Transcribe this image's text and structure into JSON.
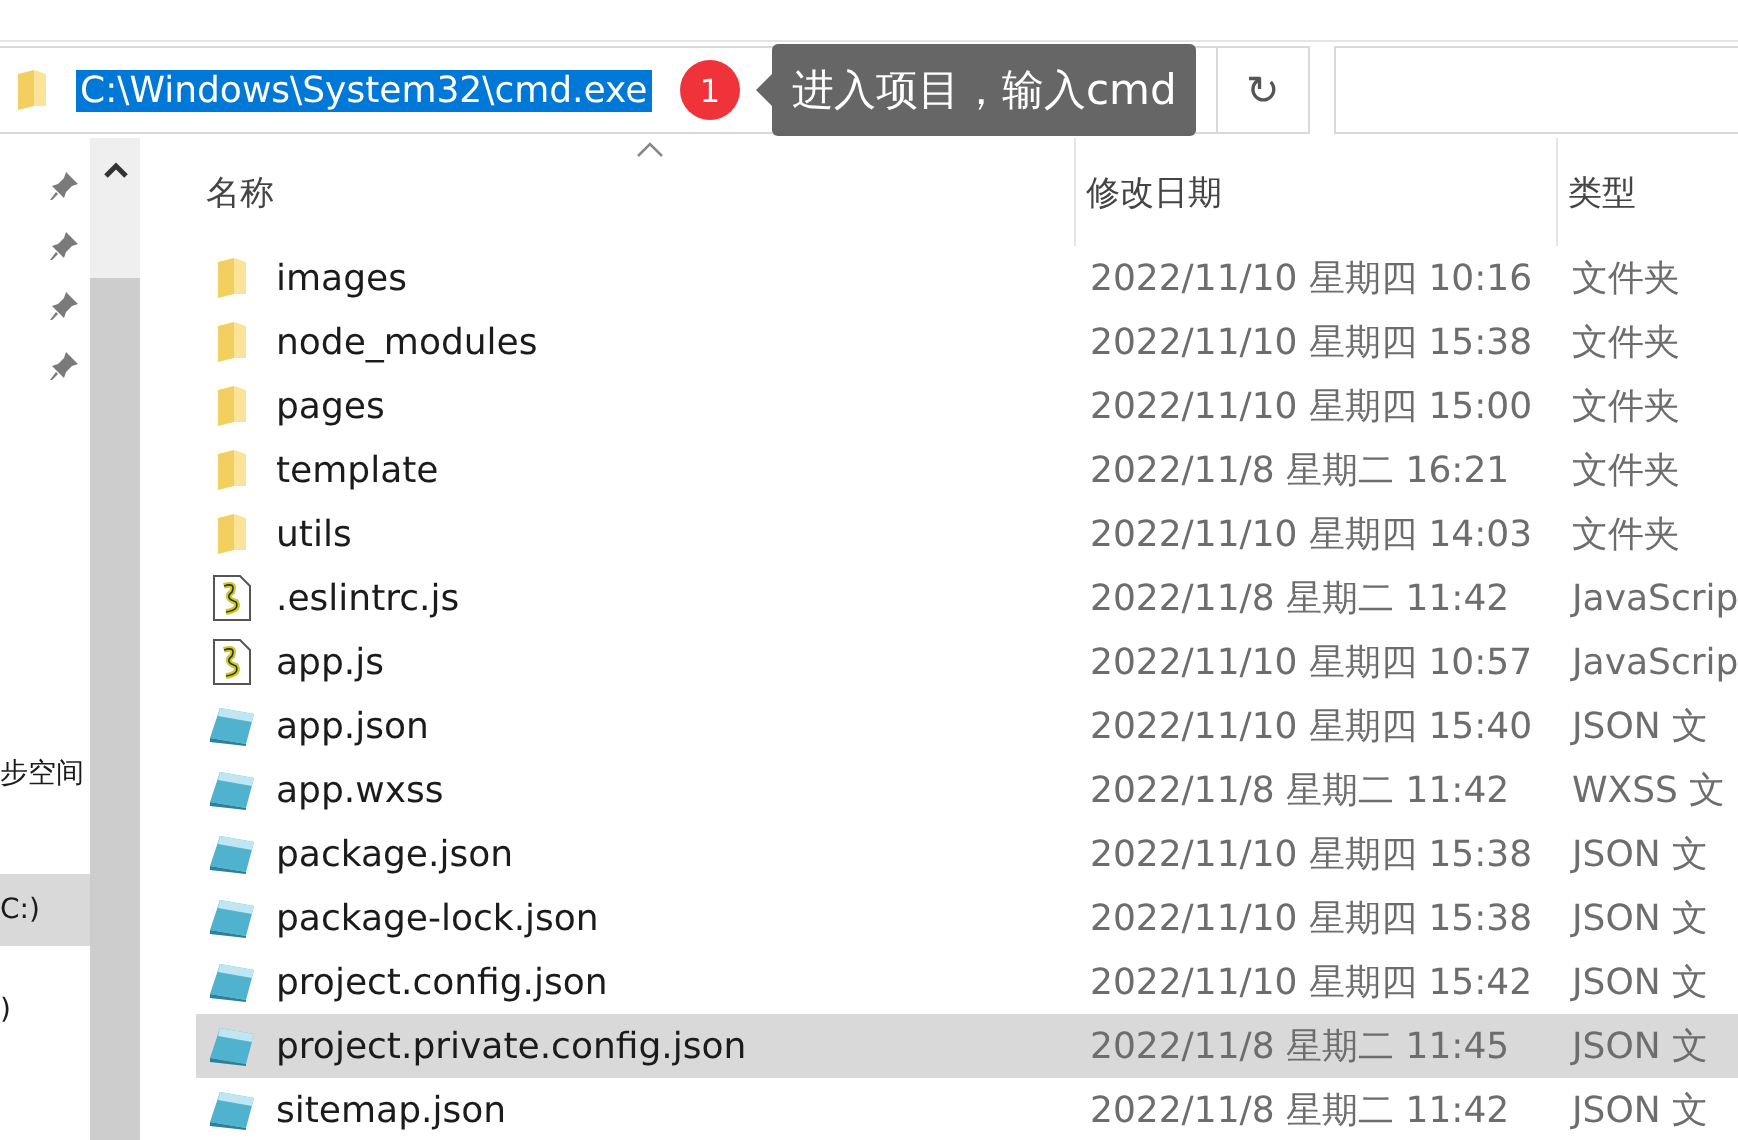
{
  "address_bar": {
    "path": "C:\\Windows\\System32\\cmd.exe",
    "refresh": "↻"
  },
  "tooltip": {
    "badge": "1",
    "text": "进入项目，输入cmd"
  },
  "columns": [
    {
      "label": "名称",
      "sorted": true
    },
    {
      "label": "修改日期",
      "sorted": false
    },
    {
      "label": "类型",
      "sorted": false
    }
  ],
  "nav": {
    "items": [
      {
        "label": "步空间",
        "selected": false
      },
      {
        "label": "C:)",
        "selected": true
      },
      {
        "label": ")",
        "selected": false
      }
    ]
  },
  "files": [
    {
      "kind": "folder",
      "name": "images",
      "date": "2022/11/10 星期四 10:16",
      "type": "文件夹",
      "selected": false
    },
    {
      "kind": "folder",
      "name": "node_modules",
      "date": "2022/11/10 星期四 15:38",
      "type": "文件夹",
      "selected": false
    },
    {
      "kind": "folder",
      "name": "pages",
      "date": "2022/11/10 星期四 15:00",
      "type": "文件夹",
      "selected": false
    },
    {
      "kind": "folder",
      "name": "template",
      "date": "2022/11/8 星期二 16:21",
      "type": "文件夹",
      "selected": false
    },
    {
      "kind": "folder",
      "name": "utils",
      "date": "2022/11/10 星期四 14:03",
      "type": "文件夹",
      "selected": false
    },
    {
      "kind": "script",
      "name": ".eslintrc.js",
      "date": "2022/11/8 星期二 11:42",
      "type": "JavaScrip",
      "selected": false
    },
    {
      "kind": "script",
      "name": "app.js",
      "date": "2022/11/10 星期四 10:57",
      "type": "JavaScrip",
      "selected": false
    },
    {
      "kind": "file",
      "name": "app.json",
      "date": "2022/11/10 星期四 15:40",
      "type": "JSON 文",
      "selected": false
    },
    {
      "kind": "file",
      "name": "app.wxss",
      "date": "2022/11/8 星期二 11:42",
      "type": "WXSS 文",
      "selected": false
    },
    {
      "kind": "file",
      "name": "package.json",
      "date": "2022/11/10 星期四 15:38",
      "type": "JSON 文",
      "selected": false
    },
    {
      "kind": "file",
      "name": "package-lock.json",
      "date": "2022/11/10 星期四 15:38",
      "type": "JSON 文",
      "selected": false
    },
    {
      "kind": "file",
      "name": "project.config.json",
      "date": "2022/11/10 星期四 15:42",
      "type": "JSON 文",
      "selected": false
    },
    {
      "kind": "file",
      "name": "project.private.config.json",
      "date": "2022/11/8 星期二 11:45",
      "type": "JSON 文",
      "selected": true
    },
    {
      "kind": "file",
      "name": "sitemap.json",
      "date": "2022/11/8 星期二 11:42",
      "type": "JSON 文",
      "selected": false
    }
  ]
}
